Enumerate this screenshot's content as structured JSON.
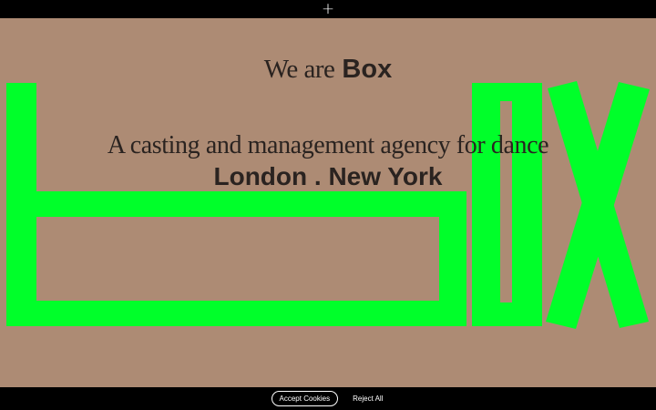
{
  "topbar": {
    "menu_icon": "plus-icon",
    "menu_glyph": "+"
  },
  "hero": {
    "we_are": "We are",
    "brand": "Box",
    "tagline": "A casting and management agency for dance",
    "cities": "London . New York"
  },
  "logo": {
    "letters": "box",
    "color": "#00ff2a"
  },
  "cookie_bar": {
    "accept_label": "Accept Cookies",
    "reject_label": "Reject All"
  },
  "colors": {
    "background": "#ad8b74",
    "bars": "#000000",
    "text": "#2a2320"
  }
}
